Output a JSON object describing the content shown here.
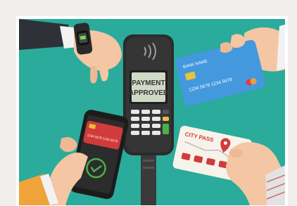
{
  "terminal_screen": {
    "line1": "PAYMENT",
    "line2": "APPROVED"
  },
  "bank_card": {
    "bank_name": "BANK NAME",
    "number": "1234 5678 1234 5678"
  },
  "red_card": {
    "number": "1234 5678 1234 5678"
  },
  "transit_card": {
    "title": "CITY PASS"
  },
  "colors": {
    "background": "#2bab9c",
    "terminal": "#2b2b2b",
    "screen": "#cfd9c6",
    "card_blue": "#3a8fd8",
    "card_red": "#d23b3c",
    "confirm_green": "#49b04b"
  },
  "icons": [
    "smartwatch-icon",
    "contactless-icon",
    "checkmark-icon",
    "bus-icon",
    "location-pin-icon"
  ]
}
